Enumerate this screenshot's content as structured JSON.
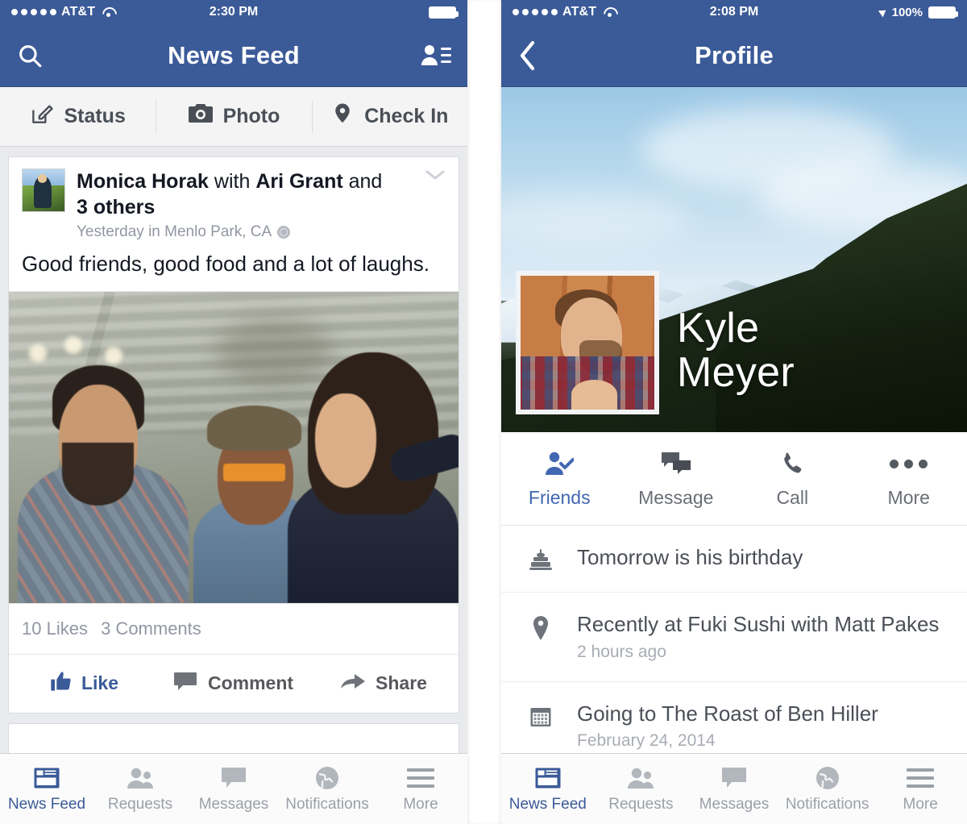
{
  "left_phone": {
    "status_bar": {
      "carrier": "AT&T",
      "time": "2:30 PM",
      "signal_icon": "signal-dots-icon",
      "wifi_icon": "wifi-icon",
      "battery_icon": "battery-icon"
    },
    "nav": {
      "title": "News Feed",
      "search_icon": "search-icon",
      "friend_requests_icon": "friend-list-icon"
    },
    "composer": [
      {
        "label": "Status",
        "icon": "compose-pencil-icon"
      },
      {
        "label": "Photo",
        "icon": "camera-icon"
      },
      {
        "label": "Check In",
        "icon": "location-pin-icon"
      }
    ],
    "post": {
      "author": "Monica Horak",
      "with_word": "with",
      "tagged": "Ari Grant",
      "and_word": "and",
      "others": "3 others",
      "meta": "Yesterday in Menlo Park, CA",
      "privacy_icon": "globe-icon",
      "caret_icon": "chevron-down-icon",
      "text": "Good friends, good food and a lot of laughs.",
      "photo_alt": "Three friends laughing together on a porch",
      "likes": "10 Likes",
      "comments": "3 Comments",
      "actions": [
        {
          "label": "Like",
          "icon": "thumbs-up-icon",
          "active": true
        },
        {
          "label": "Comment",
          "icon": "comment-bubble-icon",
          "active": false
        },
        {
          "label": "Share",
          "icon": "share-arrow-icon",
          "active": false
        }
      ]
    },
    "tabbar": [
      {
        "label": "News Feed",
        "icon": "news-feed-icon",
        "active": true
      },
      {
        "label": "Requests",
        "icon": "friend-requests-icon",
        "active": false
      },
      {
        "label": "Messages",
        "icon": "messages-icon",
        "active": false
      },
      {
        "label": "Notifications",
        "icon": "notifications-globe-icon",
        "active": false
      },
      {
        "label": "More",
        "icon": "hamburger-menu-icon",
        "active": false
      }
    ]
  },
  "right_phone": {
    "status_bar": {
      "carrier": "AT&T",
      "time": "2:08 PM",
      "battery_percent": "100%",
      "signal_icon": "signal-dots-icon",
      "wifi_icon": "wifi-icon",
      "location_icon": "location-arrow-icon",
      "battery_icon": "battery-icon"
    },
    "nav": {
      "title": "Profile",
      "back_icon": "chevron-left-icon"
    },
    "profile": {
      "name_line1": "Kyle",
      "name_line2": "Meyer",
      "cover_alt": "Snow-capped mountain ridge under a blue sky",
      "avatar_alt": "Portrait of Kyle Meyer in a plaid shirt"
    },
    "profile_actions": [
      {
        "label": "Friends",
        "icon": "friend-check-icon",
        "active": true
      },
      {
        "label": "Message",
        "icon": "message-bubbles-icon",
        "active": false
      },
      {
        "label": "Call",
        "icon": "phone-handset-icon",
        "active": false
      },
      {
        "label": "More",
        "icon": "ellipsis-icon",
        "active": false
      }
    ],
    "info_rows": [
      {
        "icon": "birthday-cake-icon",
        "title": "Tomorrow is his birthday",
        "sub": ""
      },
      {
        "icon": "location-pin-icon",
        "title": "Recently at Fuki Sushi with Matt Pakes",
        "sub": "2 hours ago"
      },
      {
        "icon": "calendar-icon",
        "title": "Going to The Roast of Ben Hiller",
        "sub": "February 24, 2014"
      }
    ],
    "tabbar": [
      {
        "label": "News Feed",
        "icon": "news-feed-icon",
        "active": true
      },
      {
        "label": "Requests",
        "icon": "friend-requests-icon",
        "active": false
      },
      {
        "label": "Messages",
        "icon": "messages-icon",
        "active": false
      },
      {
        "label": "Notifications",
        "icon": "notifications-globe-icon",
        "active": false
      },
      {
        "label": "More",
        "icon": "hamburger-menu-icon",
        "active": false
      }
    ]
  },
  "colors": {
    "brand_navy": "#3b5a98",
    "brand_blue": "#4267b2",
    "feed_bg": "#e9eaed",
    "text_dark": "#141823",
    "text_muted": "#9197a3"
  }
}
